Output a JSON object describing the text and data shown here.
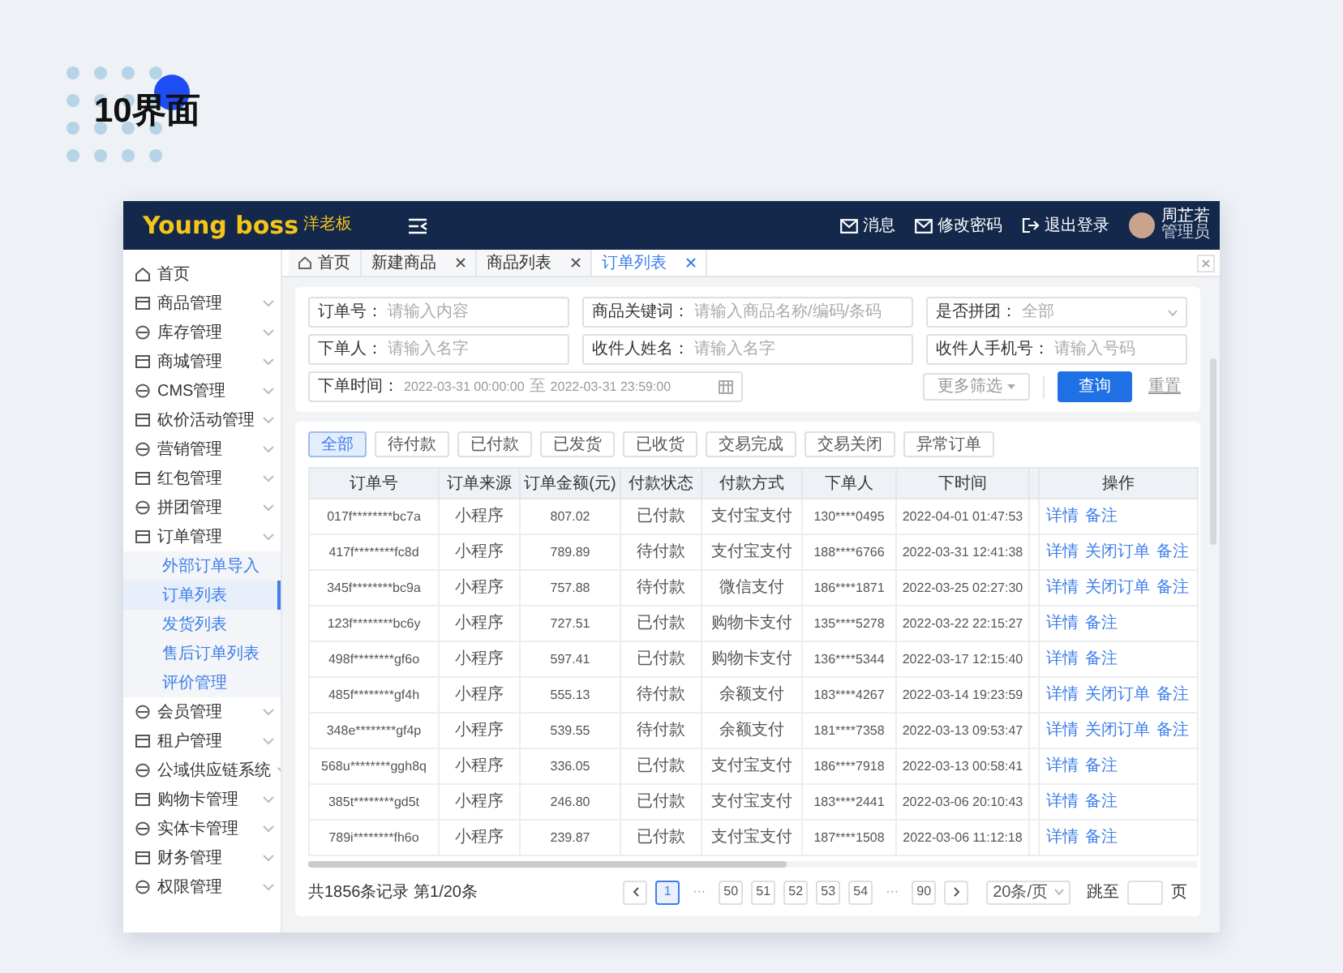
{
  "page_title": "10界面",
  "header": {
    "logo": "Young boss",
    "logo_badge": "洋老板",
    "actions": [
      {
        "label": "消息",
        "kind": "mail"
      },
      {
        "label": "修改密码",
        "kind": "mail"
      },
      {
        "label": "退出登录",
        "kind": "logout"
      }
    ],
    "user": {
      "name": "周芷若",
      "role": "管理员"
    }
  },
  "tabs": [
    {
      "label": "首页",
      "kind": "home",
      "selected": false
    },
    {
      "label": "新建商品",
      "kind": "page",
      "selected": false
    },
    {
      "label": "商品列表",
      "kind": "page",
      "selected": false
    },
    {
      "label": "订单列表",
      "kind": "page",
      "selected": true
    }
  ],
  "sidebar": {
    "items": [
      {
        "label": "首页",
        "kind": "link"
      },
      {
        "label": "商品管理",
        "kind": "group"
      },
      {
        "label": "库存管理",
        "kind": "group"
      },
      {
        "label": "商城管理",
        "kind": "group"
      },
      {
        "label": "CMS管理",
        "kind": "group"
      },
      {
        "label": "砍价活动管理",
        "kind": "group"
      },
      {
        "label": "营销管理",
        "kind": "group"
      },
      {
        "label": "红包管理",
        "kind": "group"
      },
      {
        "label": "拼团管理",
        "kind": "group"
      },
      {
        "label": "订单管理",
        "kind": "group",
        "children": [
          {
            "label": "外部订单导入",
            "selected": false
          },
          {
            "label": "订单列表",
            "selected": true
          },
          {
            "label": "发货列表",
            "selected": false
          },
          {
            "label": "售后订单列表",
            "selected": false
          },
          {
            "label": "评价管理",
            "selected": false
          }
        ]
      },
      {
        "label": "会员管理",
        "kind": "group"
      },
      {
        "label": "租户管理",
        "kind": "group"
      },
      {
        "label": "公域供应链系统",
        "kind": "group"
      },
      {
        "label": "购物卡管理",
        "kind": "group"
      },
      {
        "label": "实体卡管理",
        "kind": "group"
      },
      {
        "label": "财务管理",
        "kind": "group"
      },
      {
        "label": "权限管理",
        "kind": "group"
      }
    ]
  },
  "filters": {
    "fields": [
      {
        "kind": "text",
        "label": "订单号：",
        "placeholder": "请输入内容"
      },
      {
        "kind": "text",
        "label": "商品关键词：",
        "placeholder": "请输入商品名称/编码/条码"
      },
      {
        "kind": "select",
        "label": "是否拼团：",
        "value": "全部"
      },
      {
        "kind": "text",
        "label": "下单人：",
        "placeholder": "请输入名字"
      },
      {
        "kind": "text",
        "label": "收件人姓名：",
        "placeholder": "请输入名字"
      },
      {
        "kind": "text",
        "label": "收件人手机号：",
        "placeholder": "请输入号码"
      }
    ],
    "date_range": {
      "label": "下单时间：",
      "start": "2022-03-31 00:00:00",
      "separator": "至",
      "end": "2022-03-31 23:59:00"
    },
    "more_button": "更多筛选",
    "search_button": "查询",
    "reset_button": "重置"
  },
  "status_tabs": [
    {
      "label": "全部",
      "selected": true
    },
    {
      "label": "待付款",
      "selected": false
    },
    {
      "label": "已付款",
      "selected": false
    },
    {
      "label": "已发货",
      "selected": false
    },
    {
      "label": "已收货",
      "selected": false
    },
    {
      "label": "交易完成",
      "selected": false
    },
    {
      "label": "交易关闭",
      "selected": false
    },
    {
      "label": "异常订单",
      "selected": false
    }
  ],
  "table": {
    "columns": [
      "订单号",
      "订单来源",
      "订单金额(元)",
      "付款状态",
      "付款方式",
      "下单人",
      "下时间",
      "操作"
    ],
    "rows": [
      {
        "cells": [
          "017f********bc7a",
          "小程序",
          "807.02",
          "已付款",
          "支付宝支付",
          "130****0495",
          "2022-04-01 01:47:53"
        ],
        "actions": [
          "详情",
          "备注"
        ]
      },
      {
        "cells": [
          "417f********fc8d",
          "小程序",
          "789.89",
          "待付款",
          "支付宝支付",
          "188****6766",
          "2022-03-31 12:41:38"
        ],
        "actions": [
          "详情",
          "关闭订单",
          "备注"
        ]
      },
      {
        "cells": [
          "345f********bc9a",
          "小程序",
          "757.88",
          "待付款",
          "微信支付",
          "186****1871",
          "2022-03-25 02:27:30"
        ],
        "actions": [
          "详情",
          "关闭订单",
          "备注"
        ]
      },
      {
        "cells": [
          "123f********bc6y",
          "小程序",
          "727.51",
          "已付款",
          "购物卡支付",
          "135****5278",
          "2022-03-22 22:15:27"
        ],
        "actions": [
          "详情",
          "备注"
        ]
      },
      {
        "cells": [
          "498f********gf6o",
          "小程序",
          "597.41",
          "已付款",
          "购物卡支付",
          "136****5344",
          "2022-03-17 12:15:40"
        ],
        "actions": [
          "详情",
          "备注"
        ]
      },
      {
        "cells": [
          "485f********gf4h",
          "小程序",
          "555.13",
          "待付款",
          "余额支付",
          "183****4267",
          "2022-03-14 19:23:59"
        ],
        "actions": [
          "详情",
          "关闭订单",
          "备注"
        ]
      },
      {
        "cells": [
          "348e********gf4p",
          "小程序",
          "539.55",
          "待付款",
          "余额支付",
          "181****7358",
          "2022-03-13 09:53:47"
        ],
        "actions": [
          "详情",
          "关闭订单",
          "备注"
        ]
      },
      {
        "cells": [
          "568u********ggh8q",
          "小程序",
          "336.05",
          "已付款",
          "支付宝支付",
          "186****7918",
          "2022-03-13 00:58:41"
        ],
        "actions": [
          "详情",
          "备注"
        ]
      },
      {
        "cells": [
          "385t********gd5t",
          "小程序",
          "246.80",
          "已付款",
          "支付宝支付",
          "183****2441",
          "2022-03-06 20:10:43"
        ],
        "actions": [
          "详情",
          "备注"
        ]
      },
      {
        "cells": [
          "789i********fh6o",
          "小程序",
          "239.87",
          "已付款",
          "支付宝支付",
          "187****1508",
          "2022-03-06 11:12:18"
        ],
        "actions": [
          "详情",
          "备注"
        ]
      }
    ]
  },
  "pagination": {
    "summary": "共1856条记录 第1/20条",
    "pages": [
      {
        "label": "1",
        "kind": "page",
        "selected": true
      },
      {
        "label": "···",
        "kind": "ellipsis"
      },
      {
        "label": "50",
        "kind": "page",
        "selected": false
      },
      {
        "label": "51",
        "kind": "page",
        "selected": false
      },
      {
        "label": "52",
        "kind": "page",
        "selected": false
      },
      {
        "label": "53",
        "kind": "page",
        "selected": false
      },
      {
        "label": "54",
        "kind": "page",
        "selected": false
      },
      {
        "label": "···",
        "kind": "ellipsis"
      },
      {
        "label": "90",
        "kind": "page",
        "selected": false
      }
    ],
    "page_size": "20条/页",
    "jump_label": "跳至",
    "jump_suffix": "页"
  }
}
